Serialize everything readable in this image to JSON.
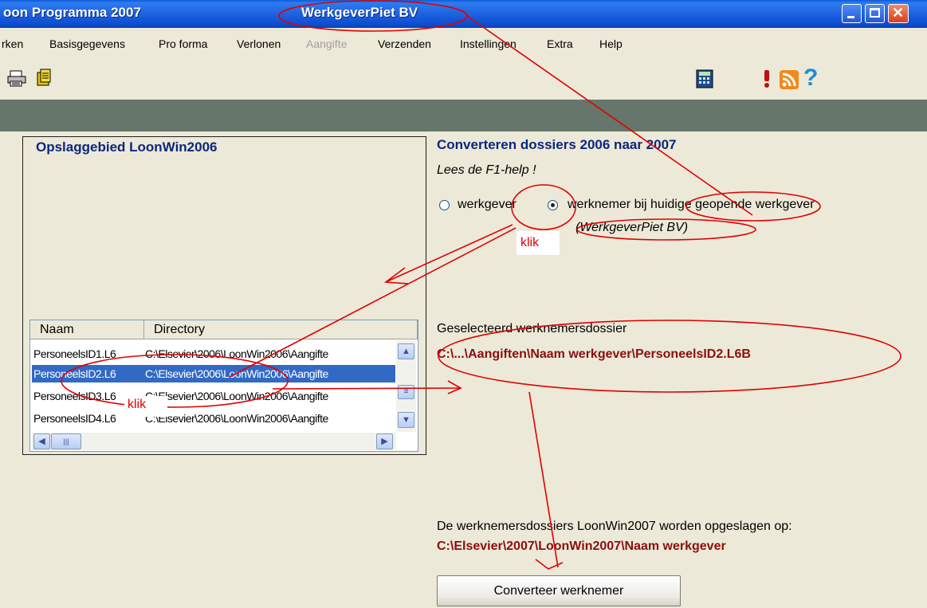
{
  "window": {
    "title": "oon Programma 2007",
    "employer": "WerkgeverPiet BV"
  },
  "menu": [
    {
      "label": "rken",
      "disabled": false
    },
    {
      "label": "Basisgegevens",
      "disabled": false
    },
    {
      "label": "Pro forma",
      "disabled": false
    },
    {
      "label": "Verlonen",
      "disabled": false
    },
    {
      "label": "Aangifte",
      "disabled": true
    },
    {
      "label": "Verzenden",
      "disabled": false
    },
    {
      "label": "Instellingen",
      "disabled": false
    },
    {
      "label": "Extra",
      "disabled": false
    },
    {
      "label": "Help",
      "disabled": false
    }
  ],
  "toolbar": {
    "left_icons": [
      "printer-icon",
      "import-icon"
    ],
    "right_icons": [
      "calculator-icon",
      "exclamation-icon",
      "rss-icon",
      "help-icon"
    ]
  },
  "storage": {
    "title": "Opslaggebied LoonWin2006",
    "columns": [
      "Naam",
      "Directory"
    ],
    "rows": [
      {
        "name": "PersoneelsID1.L6",
        "dir": "C:\\Elsevier\\2006\\LoonWin2006\\Aangifte",
        "selected": false
      },
      {
        "name": "PersoneelsID2.L6",
        "dir": "C:\\Elsevier\\2006\\LoonWin2006\\Aangifte",
        "selected": true
      },
      {
        "name": "PersoneelsID3.L6",
        "dir": "C:\\Elsevier\\2006\\LoonWin2006\\Aangifte",
        "selected": false
      },
      {
        "name": "PersoneelsID4.L6",
        "dir": "C:\\Elsevier\\2006\\LoonWin2006\\Aangifte",
        "selected": false
      }
    ]
  },
  "convert": {
    "title": "Converteren dossiers 2006 naar 2007",
    "help_hint": "Lees de F1-help !",
    "radio_employer": "werkgever",
    "radio_employee": "werknemer bij huidige geopende werkgever",
    "selected_radio": "werknemer",
    "current_employer": "(WerkgeverPiet BV)",
    "selected_label": "Geselecteerd werknemersdossier",
    "selected_path": "C:\\...\\Aangiften\\Naam werkgever\\PersoneelsID2.L6B",
    "save_label": "De werknemersdossiers LoonWin2007 worden opgeslagen op:",
    "save_path": "C:\\Elsevier\\2007\\LoonWin2007\\Naam werkgever",
    "button": "Converteer werknemer"
  },
  "annotations": {
    "click1": "klik",
    "click2": "klik"
  },
  "colors": {
    "annotation": "#e00000",
    "heading": "#0c2680",
    "path": "#8b0e0e",
    "selection": "#316ac5"
  }
}
